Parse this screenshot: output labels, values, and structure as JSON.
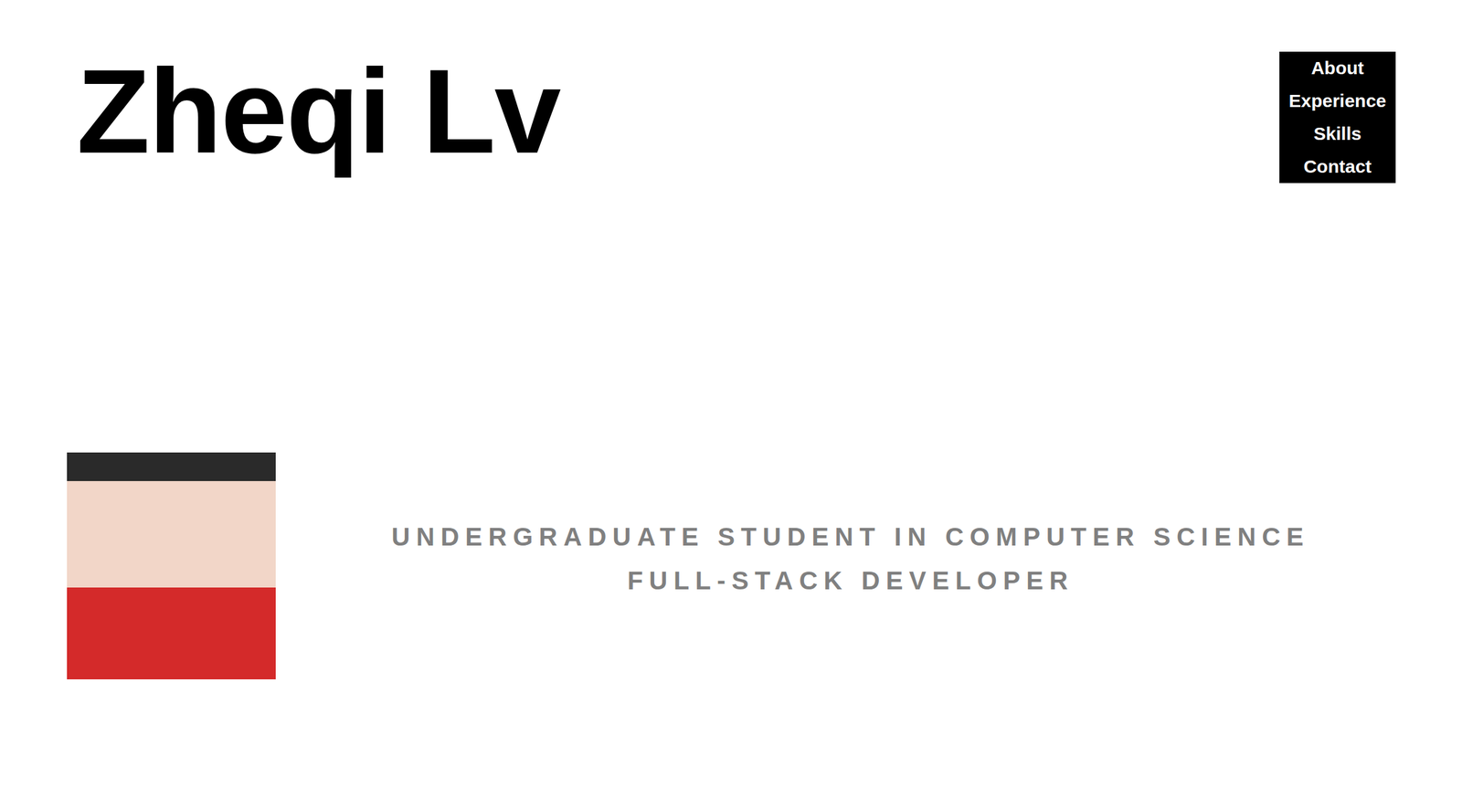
{
  "header": {
    "name": "Zheqi Lv"
  },
  "nav": [
    "About",
    "Experience",
    "Skills",
    "Contact"
  ],
  "hero": {
    "tagline": [
      "UNDERGRADUATE STUDENT IN COMPUTER SCIENCE",
      "FULL-STACK DEVELOPER"
    ]
  }
}
